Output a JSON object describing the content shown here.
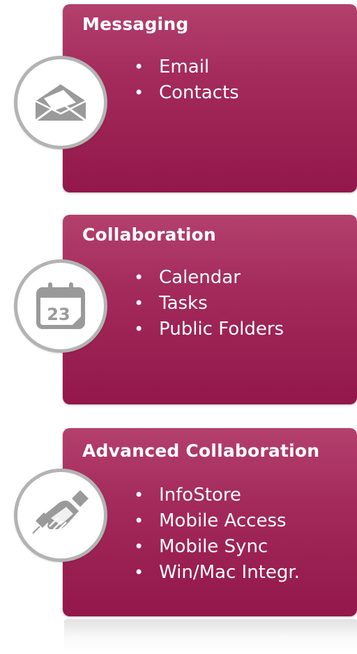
{
  "sections": [
    {
      "title": "Messaging",
      "icon": "envelope-icon",
      "items": [
        "Email",
        "Contacts"
      ]
    },
    {
      "title": "Collaboration",
      "icon": "calendar-icon",
      "calendar_day": "23",
      "items": [
        "Calendar",
        "Tasks",
        "Public Folders"
      ]
    },
    {
      "title": "Advanced Collaboration",
      "icon": "handshake-icon",
      "items": [
        "InfoStore",
        "Mobile Access",
        "Mobile Sync",
        "Win/Mac Integr."
      ]
    }
  ],
  "colors": {
    "card_top": "#b3406d",
    "card_bottom": "#93174a",
    "icon_gray": "#9a9a9a",
    "ring_gray": "#b3b3b3",
    "text": "#ffffff"
  }
}
